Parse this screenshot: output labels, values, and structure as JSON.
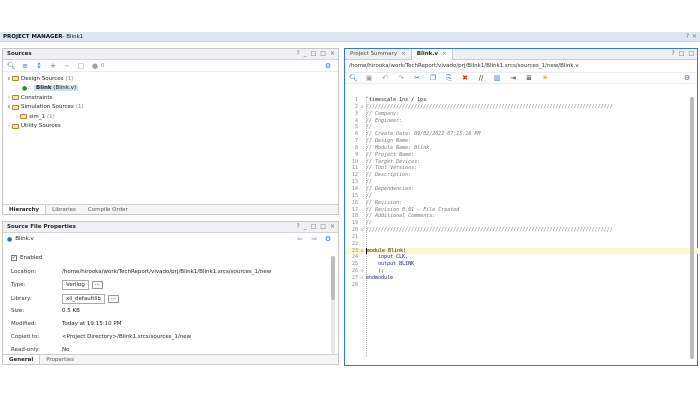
{
  "app": {
    "title": "PROJECT MANAGER",
    "subtitle": " - Blink1",
    "controls": [
      "?",
      "×"
    ]
  },
  "sources": {
    "title": "Sources",
    "header_controls": [
      "?",
      "_",
      "□",
      "□",
      "×"
    ],
    "badge_count": "0",
    "tree": [
      {
        "label": "Design Sources",
        "count": "(1)",
        "level": 0,
        "expanded": true
      },
      {
        "label": "Blink",
        "extra": "(Blink.v)",
        "level": 1,
        "selected": true
      },
      {
        "label": "Constraints",
        "count": "",
        "level": 0
      },
      {
        "label": "Simulation Sources",
        "count": "(1)",
        "level": 0,
        "expanded": true
      },
      {
        "label": "sim_1",
        "count": "(1)",
        "level": 1
      },
      {
        "label": "Utility Sources",
        "count": "",
        "level": 0
      }
    ],
    "tabs": [
      "Hierarchy",
      "Libraries",
      "Compile Order"
    ]
  },
  "props": {
    "title": "Source File Properties",
    "header_controls": [
      "?",
      "_",
      "□",
      "□",
      "×"
    ],
    "file": "Blink.v",
    "enabled_label": "Enabled",
    "rows": [
      {
        "label": "Location:",
        "value": "/home/hirooka/work/TechReport/vivado/prj/Blink1/Blink1.srcs/sources_1/new"
      },
      {
        "label": "Type:",
        "value": "Verilog",
        "box": true
      },
      {
        "label": "Library:",
        "value": "xil_defaultlib",
        "box": true
      },
      {
        "label": "Size:",
        "value": "0.5 KB"
      },
      {
        "label": "Modified:",
        "value": "Today at 19:15:10 PM"
      },
      {
        "label": "Copied to:",
        "value": "<Project Directory>/Blink1.srcs/sources_1/new"
      },
      {
        "label": "Read-only:",
        "value": "No"
      }
    ],
    "tabs": [
      "General",
      "Properties"
    ]
  },
  "editor": {
    "tabs": [
      {
        "label": "Project Summary",
        "active": false
      },
      {
        "label": "Blink.v",
        "active": true
      }
    ],
    "header_controls": [
      "?",
      "□",
      "□"
    ],
    "path": "/home/hirooka/work/TechReport/vivado/prj/Blink1/Blink1.srcs/sources_1/new/Blink.v",
    "lines": [
      "`timescale 1ns / 1ps",
      "//////////////////////////////////////////////////////////////////////////////////",
      "// Company: ",
      "// Engineer: ",
      "// ",
      "// Create Date: 09/02/2022 07:15:16 PM",
      "// Design Name: ",
      "// Module Name: Blink",
      "// Project Name: ",
      "// Target Devices: ",
      "// Tool Versions: ",
      "// Description: ",
      "// ",
      "// Dependencies: ",
      "// ",
      "// Revision:",
      "// Revision 0.01 - File Created",
      "// Additional Comments:",
      "// ",
      "//////////////////////////////////////////////////////////////////////////////////",
      "",
      "",
      "module Blink(",
      "    input CLK,",
      "    output BLINK",
      "    );",
      "endmodule",
      ""
    ]
  }
}
